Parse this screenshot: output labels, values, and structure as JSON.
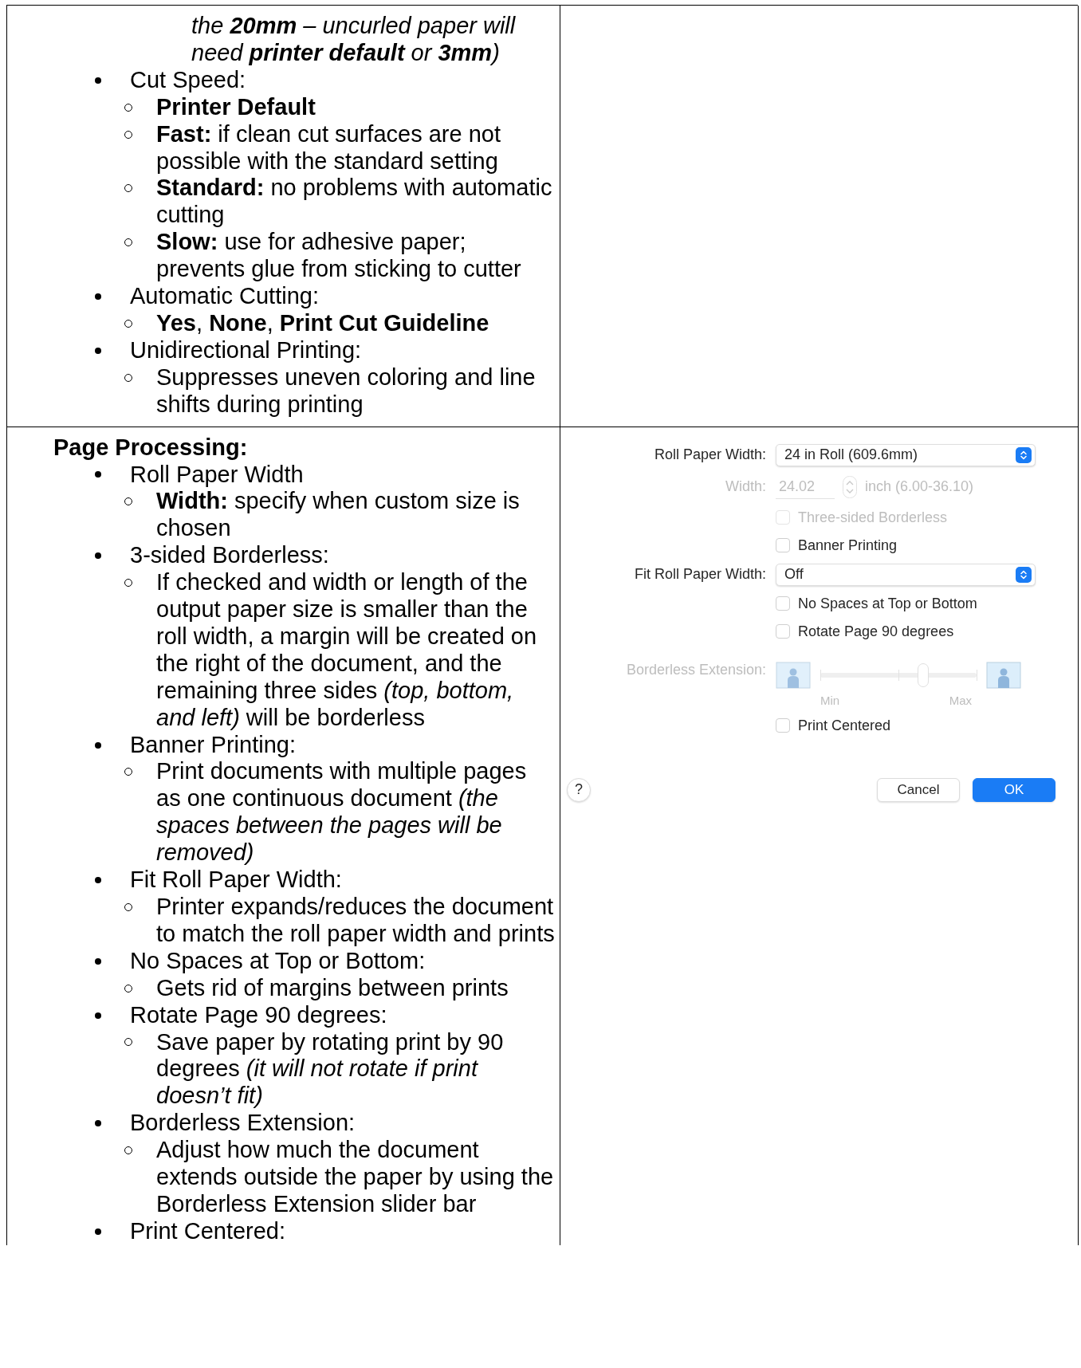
{
  "top_cell": {
    "items": [
      {
        "kind": "continuation",
        "text": "the **20mm** – uncurled paper will need **printer default** or **3mm**)"
      },
      {
        "kind": "bullet",
        "text": "Cut Speed:",
        "children": [
          {
            "text": "Printer Default",
            "bold": true
          },
          {
            "text": "**Fast:** if clean cut surfaces are not possible with the standard setting",
            "bold": false
          },
          {
            "text": "**Standard:** no problems with automatic cutting",
            "bold": false
          },
          {
            "text": "**Slow:** use for adhesive paper; prevents glue from sticking to cutter",
            "bold": false
          }
        ]
      },
      {
        "kind": "bullet",
        "text": "Automatic Cutting:",
        "children": [
          {
            "text": "**Yes**, **None**, **Print Cut Guideline**",
            "bold": false
          }
        ]
      },
      {
        "kind": "bullet",
        "text": "Unidirectional Printing:",
        "children": [
          {
            "text": "Suppresses uneven coloring and line shifts during printing",
            "bold": false
          }
        ]
      }
    ]
  },
  "bottom_cell": {
    "heading": "Page Processing:",
    "items": [
      {
        "kind": "bullet",
        "text": "Roll Paper Width",
        "children": [
          {
            "text": "**Width:** specify when custom size is chosen",
            "bold": false
          }
        ]
      },
      {
        "kind": "bullet",
        "text": "3-sided Borderless:",
        "children": [
          {
            "text": "If checked and width or length of the output paper size is smaller than the roll width, a margin will be created on the right of the document, and the remaining three sides *(top, bottom, and left)* will be borderless",
            "bold": false
          }
        ]
      },
      {
        "kind": "bullet",
        "text": "Banner Printing:",
        "children": [
          {
            "text": "Print documents with multiple pages as one continuous document *(the spaces between the pages will be removed)*",
            "bold": false
          }
        ]
      },
      {
        "kind": "bullet",
        "text": "Fit Roll Paper Width:",
        "children": [
          {
            "text": "Printer expands/reduces the document to match the roll paper width and prints",
            "bold": false
          }
        ]
      },
      {
        "kind": "bullet",
        "text": "No Spaces at Top or Bottom:",
        "children": [
          {
            "text": "Gets rid of margins between prints",
            "bold": false
          }
        ]
      },
      {
        "kind": "bullet",
        "text": "Rotate Page 90 degrees:",
        "children": [
          {
            "text": "Save paper by rotating print by 90 degrees *(it will not rotate if print doesn’t fit)*",
            "bold": false
          }
        ]
      },
      {
        "kind": "bullet",
        "text": "Borderless Extension:",
        "children": [
          {
            "text": "Adjust how much the document extends outside the paper by using the Borderless Extension slider bar",
            "bold": false
          }
        ]
      },
      {
        "kind": "bullet",
        "text": "Print Centered:"
      }
    ]
  },
  "dialog": {
    "rows": [
      {
        "kind": "popup",
        "label": "Roll Paper Width:",
        "value": "24 in Roll (609.6mm)",
        "disabled": false
      },
      {
        "kind": "stepper",
        "label": "Width:",
        "value": "24.02",
        "unit": "inch (6.00-36.10)",
        "disabled": true
      },
      {
        "kind": "checkbox",
        "text": "Three-sided Borderless",
        "checked": false,
        "disabled": true
      },
      {
        "kind": "checkbox",
        "text": "Banner Printing",
        "checked": false,
        "disabled": false
      },
      {
        "kind": "popup",
        "label": "Fit Roll Paper Width:",
        "value": "Off",
        "disabled": false
      },
      {
        "kind": "checkbox",
        "text": "No Spaces at Top or Bottom",
        "checked": false,
        "disabled": false
      },
      {
        "kind": "checkbox",
        "text": "Rotate Page 90 degrees",
        "checked": false,
        "disabled": false
      },
      {
        "kind": "slider",
        "label": "Borderless Extension:",
        "level": 0.66,
        "min_label": "Min",
        "max_label": "Max",
        "disabled": true
      },
      {
        "kind": "checkbox",
        "text": "Print Centered",
        "checked": false,
        "disabled": false
      }
    ],
    "help": "?",
    "buttons": [
      {
        "label": "Cancel",
        "default": false
      },
      {
        "label": "OK",
        "default": true
      }
    ]
  }
}
